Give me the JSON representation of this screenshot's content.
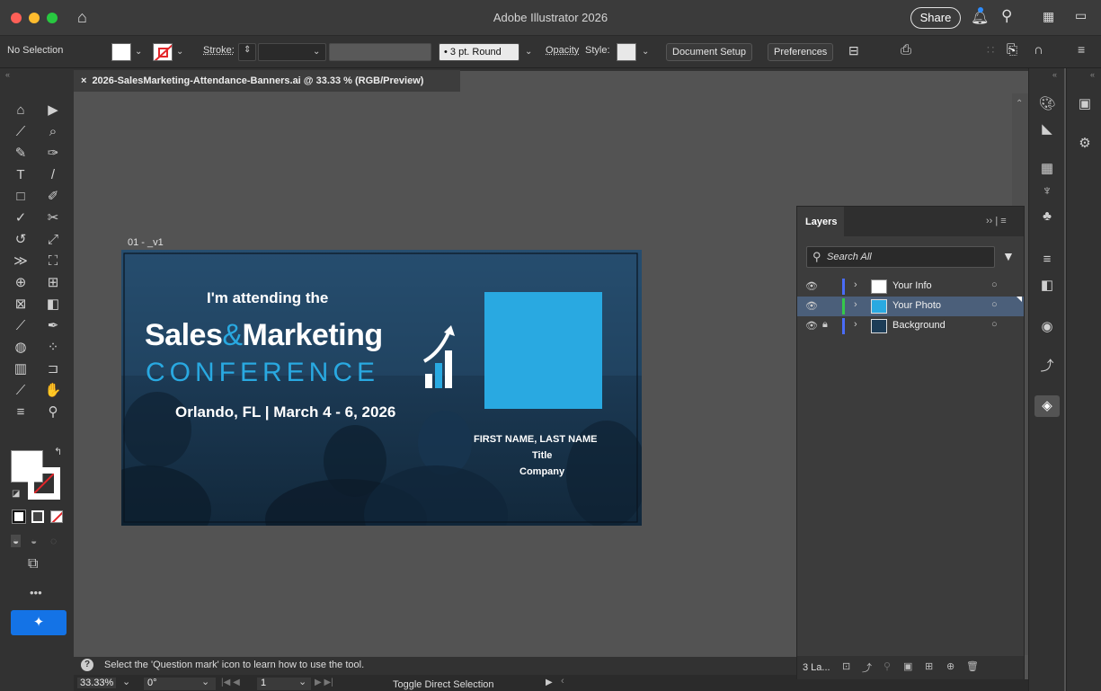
{
  "app": {
    "title": "Adobe Illustrator 2026",
    "share_label": "Share"
  },
  "control_bar": {
    "selection": "No Selection",
    "stroke_label": "Stroke:",
    "brush_label": "3 pt. Round",
    "opacity_label": "Opacity",
    "style_label": "Style:",
    "document_setup": "Document Setup",
    "preferences": "Preferences"
  },
  "document": {
    "tab_title": "2026-SalesMarketing-Attendance-Banners.ai @ 33.33 % (RGB/Preview)",
    "close_glyph": "×",
    "artboard_label": "01 - _v1"
  },
  "artwork": {
    "line1": "I'm attending the",
    "sales": "Sales",
    "amp": "&",
    "marketing": "Marketing",
    "conference": "CONFERENCE",
    "location": "Orlando, FL | March 4 - 6, 2026",
    "name": "FIRST NAME, LAST NAME",
    "title": "Title",
    "company": "Company",
    "colors": {
      "bg": "#1d3d57",
      "accent": "#29a9e1",
      "photo": "#29a9e1"
    }
  },
  "layers_panel": {
    "tab_label": "Layers",
    "search_placeholder": "Search All",
    "layers": [
      {
        "name": "Your Info",
        "color": "#4a6cf7",
        "selected": false,
        "locked": false
      },
      {
        "name": "Your Photo",
        "color": "#35c84a",
        "selected": true,
        "locked": false
      },
      {
        "name": "Background",
        "color": "#4a6cf7",
        "selected": false,
        "locked": true
      }
    ],
    "footer_count": "3 La..."
  },
  "status": {
    "hint": "Select the 'Question mark' icon to learn how to use the tool.",
    "zoom": "33.33%",
    "rotation": "0°",
    "artboard_num": "1",
    "tool_name": "Toggle Direct Selection"
  }
}
